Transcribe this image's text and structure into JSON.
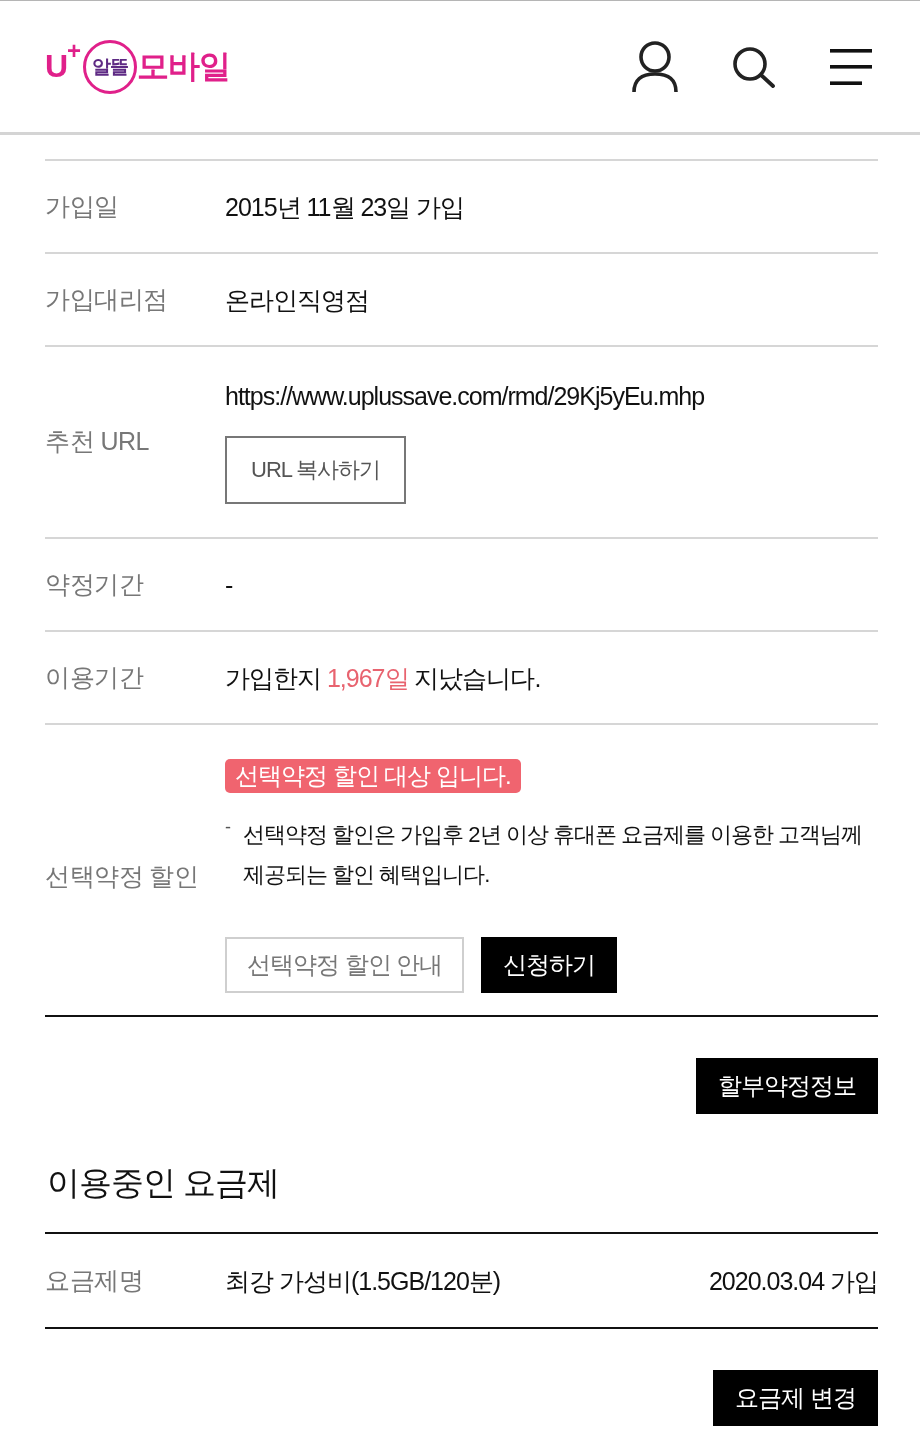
{
  "header": {
    "logo": [
      {
        "kind": "letter",
        "text": "U"
      },
      {
        "kind": "sup",
        "text": "+"
      },
      {
        "kind": "ring",
        "text": "알뜰"
      },
      {
        "kind": "letter",
        "text": "모바일"
      }
    ]
  },
  "info_rows": [
    {
      "kind": "text",
      "label": "가입일",
      "value": "2015년 11월 23일 가입"
    },
    {
      "kind": "text",
      "label": "가입대리점",
      "value": "온라인직영점"
    },
    {
      "kind": "url",
      "label": "추천 URL",
      "value": "https://www.uplussave.com/rmd/29Kj5yEu.mhp",
      "button": "URL 복사하기"
    },
    {
      "kind": "text",
      "label": "약정기간",
      "value": "-"
    },
    {
      "kind": "parts",
      "label": "이용기간",
      "parts": [
        {
          "text": "가입한지 ",
          "highlight": false
        },
        {
          "text": "1,967일",
          "highlight": true
        },
        {
          "text": " 지났습니다.",
          "highlight": false
        }
      ]
    },
    {
      "kind": "discount",
      "label": "선택약정 할인",
      "badge": "선택약정 할인 대상 입니다.",
      "notes": [
        {
          "bullet": "-",
          "text": "선택약정 할인은 가입후 2년 이상 휴대폰 요금제를 이용한 고객님께 제공되는 할인 혜택입니다."
        }
      ],
      "buttons": [
        {
          "kind": "outline",
          "label": "선택약정 할인 안내"
        },
        {
          "kind": "solid",
          "label": "신청하기"
        }
      ]
    }
  ],
  "installment_button": "할부약정정보",
  "plan_section": {
    "title": "이용중인 요금제",
    "rows": [
      {
        "label": "요금제명",
        "value": "최강 가성비(1.5GB/120분)",
        "date": "2020.03.04 가입"
      }
    ],
    "button": "요금제 변경"
  }
}
